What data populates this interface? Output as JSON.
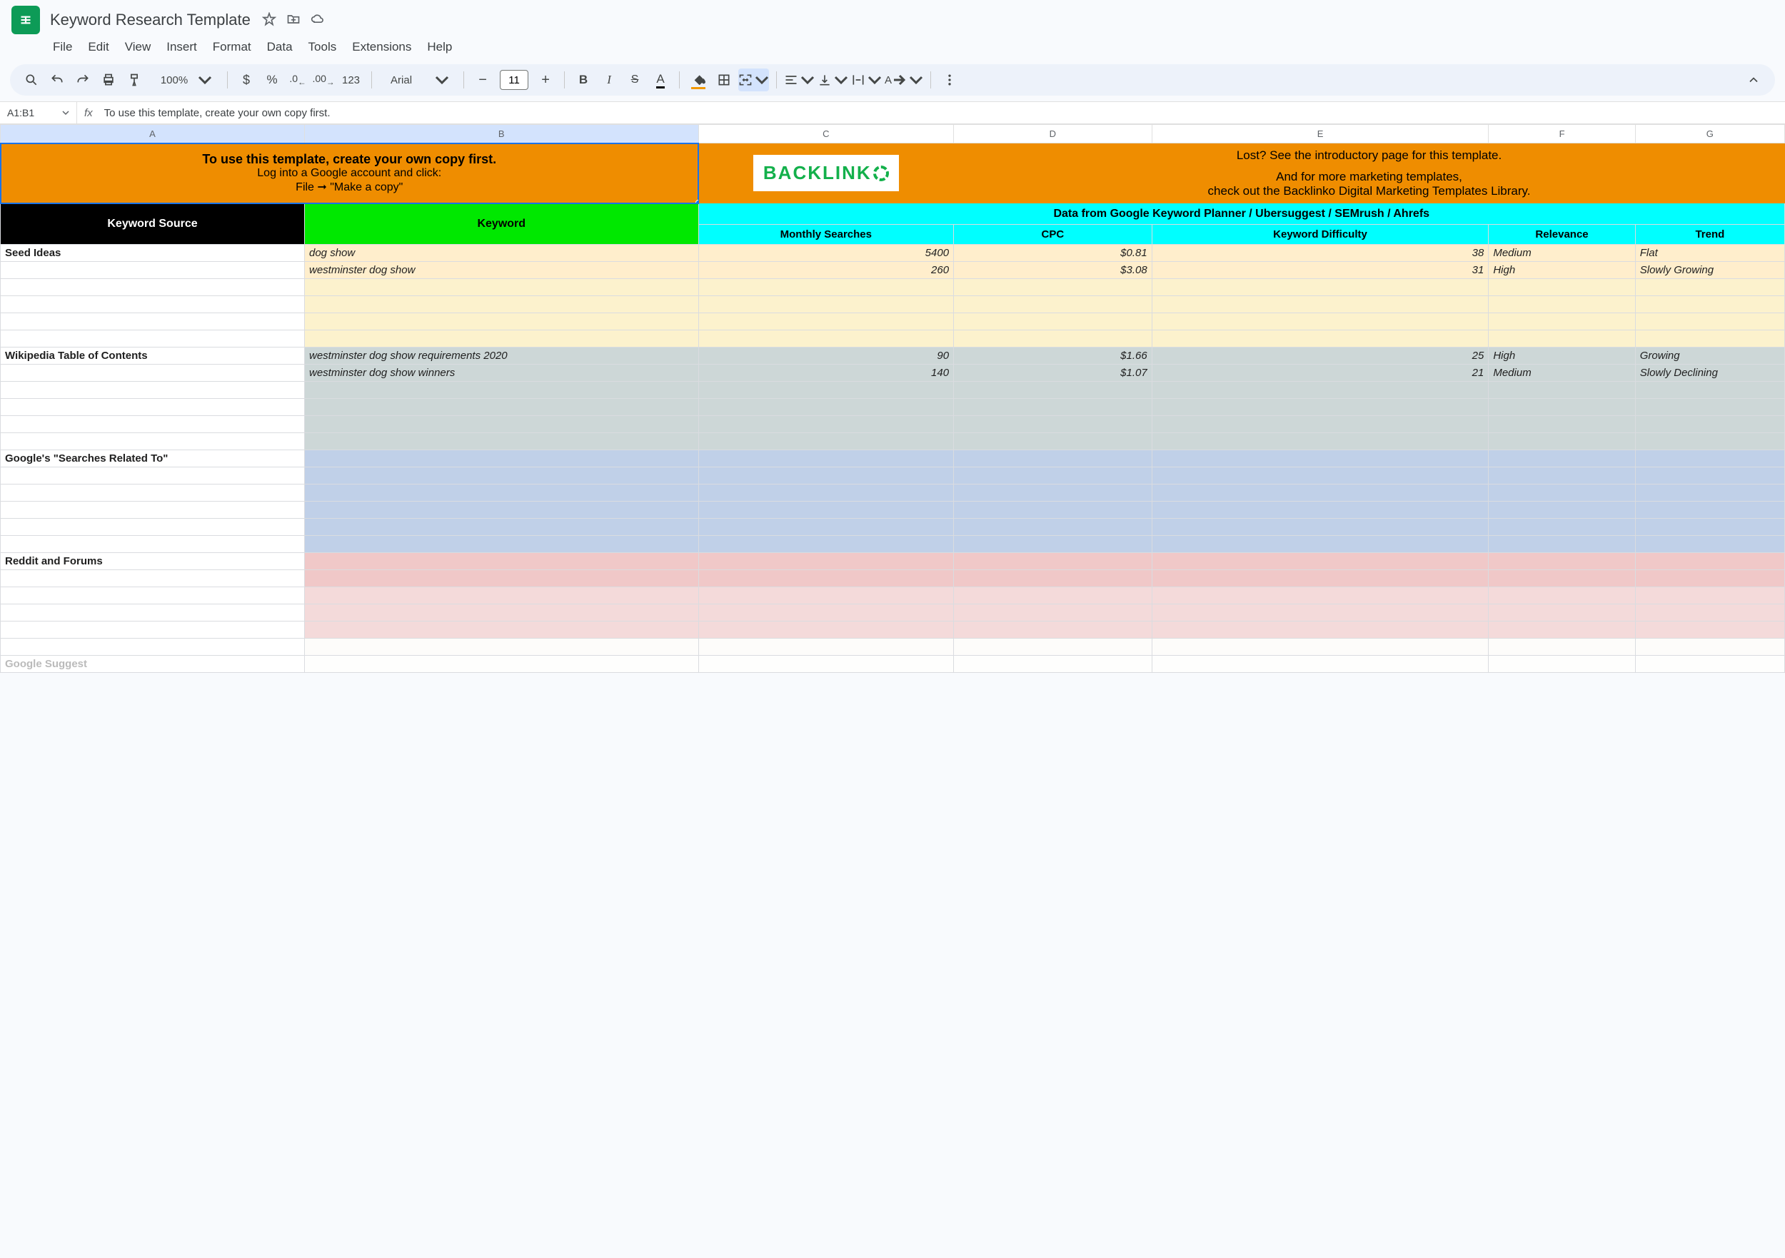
{
  "title": "Keyword Research Template",
  "menus": [
    "File",
    "Edit",
    "View",
    "Insert",
    "Format",
    "Data",
    "Tools",
    "Extensions",
    "Help"
  ],
  "toolbar": {
    "zoom": "100%",
    "format123": "123",
    "font": "Arial",
    "fontSize": "11"
  },
  "nameBox": "A1:B1",
  "formula": "To use this template, create your own copy first.",
  "columns": [
    "A",
    "B",
    "C",
    "D",
    "E",
    "F",
    "G"
  ],
  "banner": {
    "title": "To use this template, create your own copy first.",
    "line1": "Log into a Google account and click:",
    "line2": "File ➞ \"Make a copy\"",
    "logo": "BACKLINK",
    "right1": "Lost? See the introductory page for this template.",
    "right2": "And for more marketing templates,",
    "right3": "check out the Backlinko Digital Marketing Templates Library."
  },
  "headers": {
    "source": "Keyword Source",
    "keyword": "Keyword",
    "dataFrom": "Data from Google Keyword Planner / Ubersuggest / SEMrush / Ahrefs",
    "monthly": "Monthly Searches",
    "cpc": "CPC",
    "difficulty": "Keyword Difficulty",
    "relevance": "Relevance",
    "trend": "Trend"
  },
  "sections": {
    "seed": "Seed Ideas",
    "wiki": "Wikipedia Table of Contents",
    "related": "Google's \"Searches Related To\"",
    "reddit": "Reddit and Forums",
    "suggest": "Google Suggest"
  },
  "rows": {
    "r1": {
      "kw": "dog show",
      "monthly": "5400",
      "cpc": "$0.81",
      "diff": "38",
      "rel": "Medium",
      "trend": "Flat"
    },
    "r2": {
      "kw": "westminster dog show",
      "monthly": "260",
      "cpc": "$3.08",
      "diff": "31",
      "rel": "High",
      "trend": "Slowly Growing"
    },
    "r3": {
      "kw": "westminster dog show requirements 2020",
      "monthly": "90",
      "cpc": "$1.66",
      "diff": "25",
      "rel": "High",
      "trend": "Growing"
    },
    "r4": {
      "kw": "westminster dog show winners",
      "monthly": "140",
      "cpc": "$1.07",
      "diff": "21",
      "rel": "Medium",
      "trend": "Slowly Declining"
    }
  }
}
